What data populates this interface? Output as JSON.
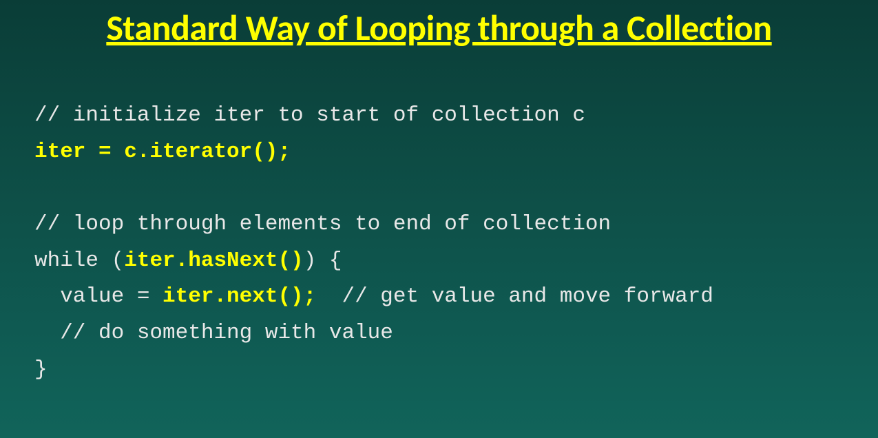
{
  "title": "Standard Way of Looping through a Collection",
  "code": {
    "line1_comment": "// initialize iter to start of collection c",
    "line2_highlight": "iter = c.iterator();",
    "line3_blank": "",
    "line4_comment": "// loop through elements to end of collection",
    "line5_pre": "while (",
    "line5_highlight": "iter.hasNext()",
    "line5_post": ") {",
    "line6_pre": "  value = ",
    "line6_highlight": "iter.next();",
    "line6_post": "  // get value and move forward",
    "line7": "  // do something with value",
    "line8": "}"
  }
}
